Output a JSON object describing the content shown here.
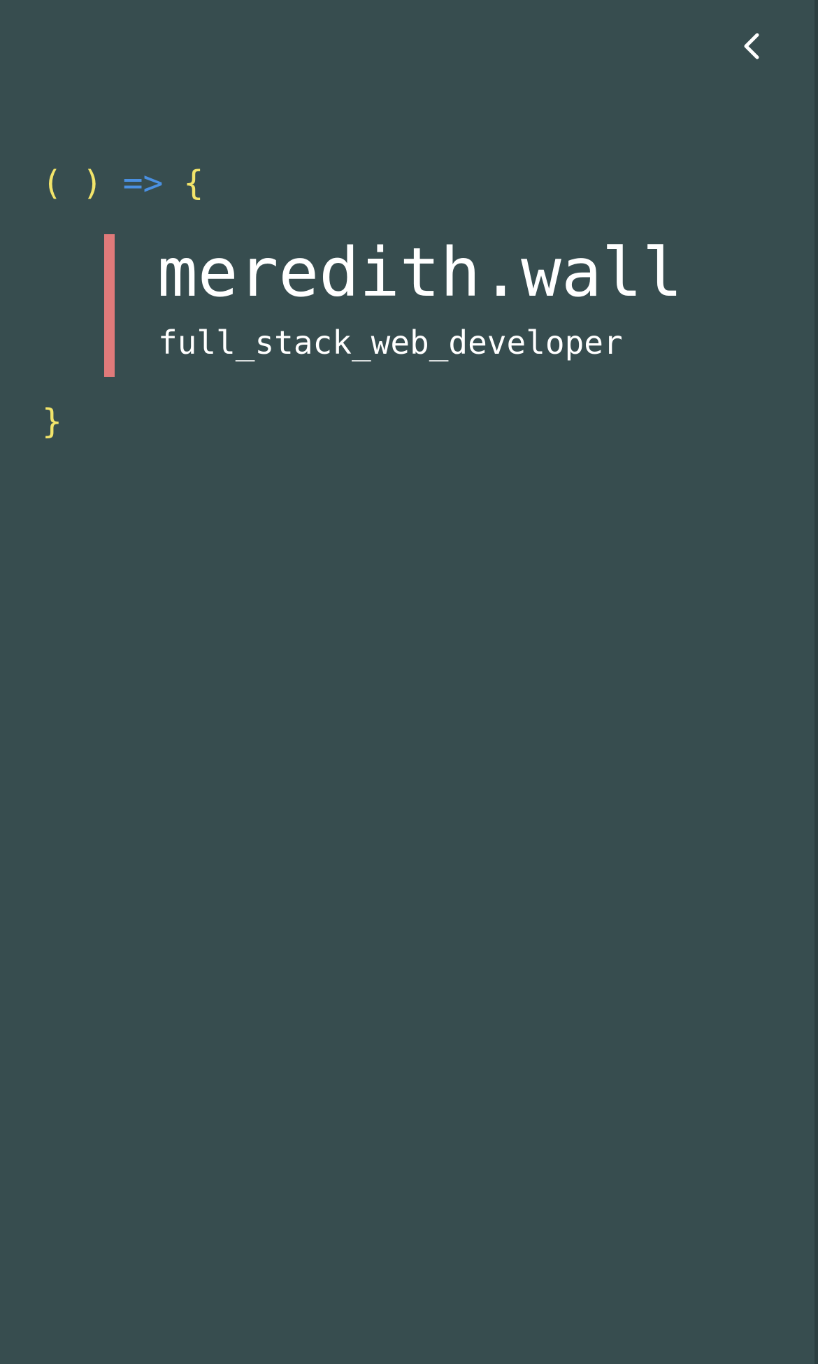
{
  "header": {
    "back_icon": "chevron-left-icon"
  },
  "code": {
    "open_parens": "( )",
    "arrow": "=>",
    "open_brace": "{",
    "close_brace": "}"
  },
  "profile": {
    "name": "meredith.wall",
    "role": "full_stack_web_developer"
  },
  "colors": {
    "background": "#374d4f",
    "accent_bar": "#e07a7a",
    "paren": "#f2e46a",
    "arrow": "#4a90e2",
    "text": "#ffffff"
  }
}
